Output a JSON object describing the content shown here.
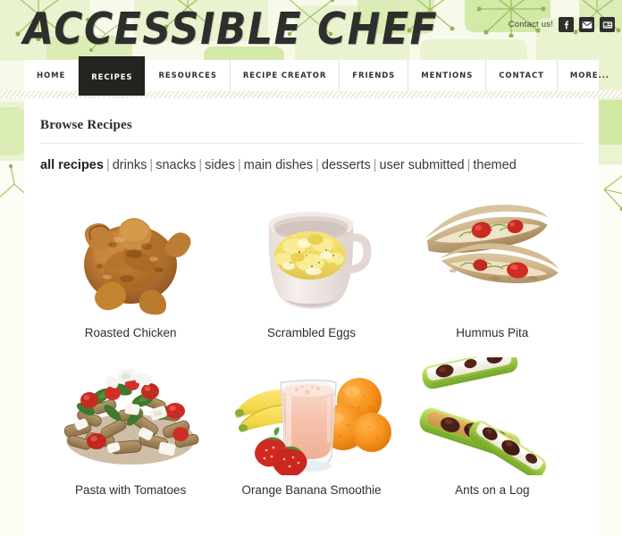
{
  "site": {
    "title": "ACCESSIBLE CHEF",
    "contact_label": "Contact us!",
    "social": [
      {
        "name": "facebook-icon",
        "glyph": "f"
      },
      {
        "name": "email-icon",
        "glyph": "envelope"
      },
      {
        "name": "youtube-icon",
        "glyph": "video"
      }
    ]
  },
  "nav": {
    "items": [
      {
        "label": "HOME",
        "active": false
      },
      {
        "label": "RECIPES",
        "active": true
      },
      {
        "label": "RESOURCES",
        "active": false
      },
      {
        "label": "RECIPE CREATOR",
        "active": false
      },
      {
        "label": "FRIENDS",
        "active": false
      },
      {
        "label": "MENTIONS",
        "active": false
      },
      {
        "label": "CONTACT",
        "active": false
      },
      {
        "label": "MORE...",
        "active": false
      }
    ]
  },
  "page": {
    "heading": "Browse Recipes"
  },
  "categories": {
    "items": [
      {
        "label": "all recipes",
        "active": true
      },
      {
        "label": "drinks",
        "active": false
      },
      {
        "label": "snacks",
        "active": false
      },
      {
        "label": "sides",
        "active": false
      },
      {
        "label": "main dishes",
        "active": false
      },
      {
        "label": "desserts",
        "active": false
      },
      {
        "label": "user submitted",
        "active": false
      },
      {
        "label": "themed",
        "active": false
      }
    ],
    "separator": "|"
  },
  "recipes": [
    {
      "label": "Roasted Chicken",
      "image": "roasted-chicken"
    },
    {
      "label": "Scrambled Eggs",
      "image": "scrambled-eggs"
    },
    {
      "label": "Hummus Pita",
      "image": "hummus-pita"
    },
    {
      "label": "Pasta with Tomatoes",
      "image": "pasta-with-tomatoes"
    },
    {
      "label": "Orange Banana Smoothie",
      "image": "orange-banana-smoothie"
    },
    {
      "label": "Ants on a Log",
      "image": "ants-on-a-log"
    }
  ],
  "colors": {
    "header_bg": "#f7faea",
    "blob_green": "#d8eab0",
    "accent_dark": "#232320",
    "content_bg": "#ffffff",
    "text": "#2f2f2d"
  }
}
